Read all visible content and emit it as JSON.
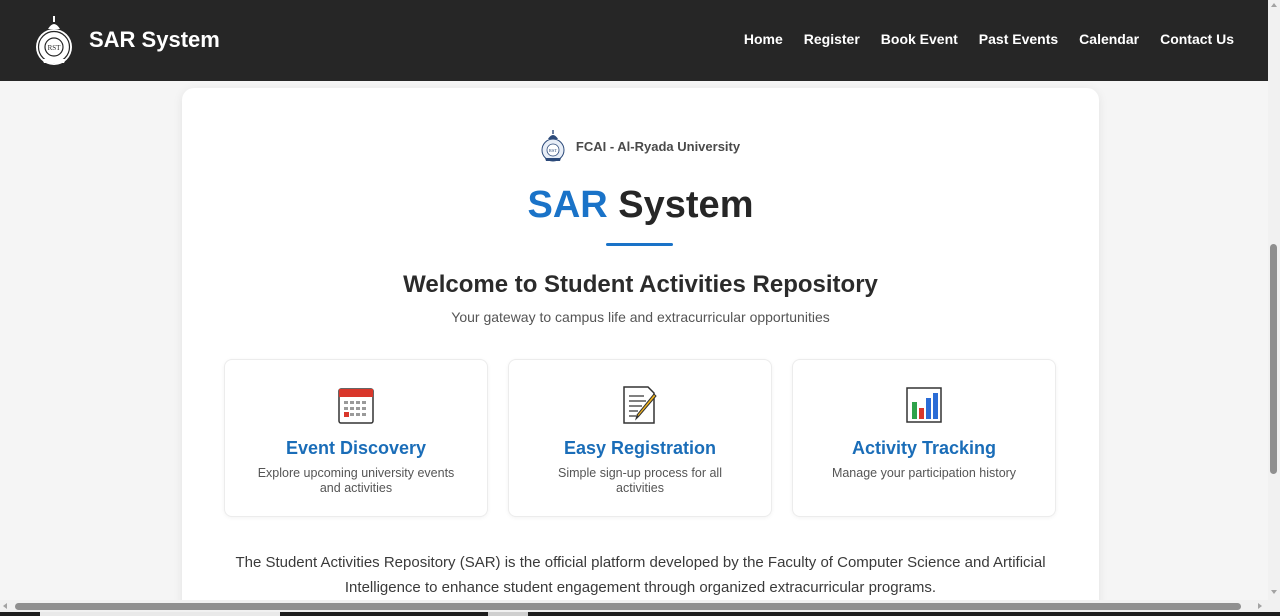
{
  "header": {
    "brand": "SAR System",
    "nav": [
      "Home",
      "Register",
      "Book Event",
      "Past Events",
      "Calendar",
      "Contact Us"
    ]
  },
  "hero": {
    "university": "FCAI - Al-Ryada University",
    "title_accent": "SAR",
    "title_rest": " System",
    "welcome": "Welcome to Student Activities Repository",
    "tagline": "Your gateway to campus life and extracurricular opportunities"
  },
  "features": [
    {
      "icon": "calendar-icon",
      "title": "Event Discovery",
      "desc": "Explore upcoming university events and activities"
    },
    {
      "icon": "memo-icon",
      "title": "Easy Registration",
      "desc": "Simple sign-up process for all activities"
    },
    {
      "icon": "bar-chart-icon",
      "title": "Activity Tracking",
      "desc": "Manage your participation history"
    }
  ],
  "about": "The Student Activities Repository (SAR) is the official platform developed by the Faculty of Computer Science and Artificial Intelligence to enhance student engagement through organized extracurricular programs.",
  "colors": {
    "navbar": "#262626",
    "accent": "#1a73c8",
    "feature_title": "#1a6db8"
  }
}
